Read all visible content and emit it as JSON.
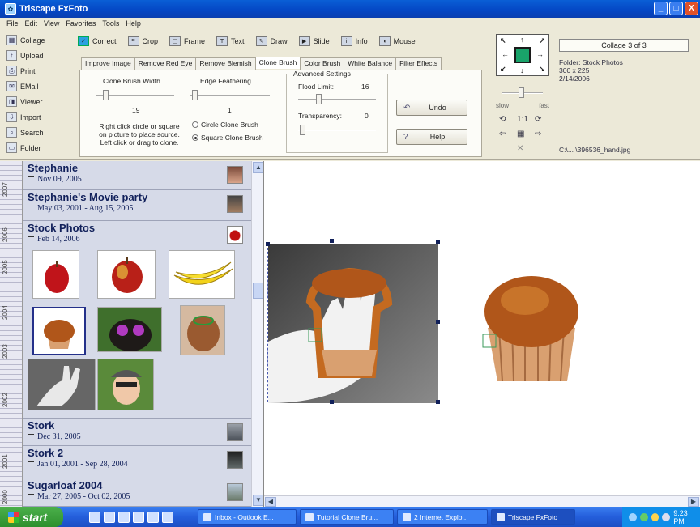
{
  "window": {
    "title": "Triscape FxFoto",
    "buttons": [
      "_",
      "□",
      "X"
    ]
  },
  "menu": [
    "File",
    "Edit",
    "View",
    "Favorites",
    "Tools",
    "Help"
  ],
  "left_tools": [
    "Collage",
    "Upload",
    "Print",
    "EMail",
    "Viewer",
    "Import",
    "Search",
    "Folder"
  ],
  "main_tabs": [
    {
      "label": "Correct",
      "active": true
    },
    {
      "label": "Crop"
    },
    {
      "label": "Frame"
    },
    {
      "label": "Text"
    },
    {
      "label": "Draw"
    },
    {
      "label": "Slide"
    },
    {
      "label": "Info"
    },
    {
      "label": "Mouse"
    }
  ],
  "sub_tabs": [
    {
      "label": "Improve Image"
    },
    {
      "label": "Remove Red Eye"
    },
    {
      "label": "Remove Blemish"
    },
    {
      "label": "Clone Brush",
      "active": true
    },
    {
      "label": "Color Brush"
    },
    {
      "label": "White Balance"
    },
    {
      "label": "Filter Effects"
    }
  ],
  "clone_panel": {
    "width_label": "Clone Brush Width",
    "width_value": "19",
    "feather_label": "Edge Feathering",
    "feather_value": "1",
    "instructions": [
      "Right click circle or square",
      "on picture to place source.",
      "Left click or drag to clone."
    ],
    "radio_circle": "Circle Clone Brush",
    "radio_square": "Square Clone Brush",
    "advanced_title": "Advanced Settings",
    "flood_label": "Flood Limit:",
    "flood_value": "16",
    "transparency_label": "Transparency:",
    "transparency_value": "0",
    "undo_label": "Undo",
    "help_label": "Help"
  },
  "nav": {
    "slow": "slow",
    "fast": "fast"
  },
  "info": {
    "collage": "Collage 3 of 3",
    "folder": "Folder: Stock Photos",
    "size": "300 x 225",
    "date": "2/14/2006",
    "path": "C:\\... \\396536_hand.jpg"
  },
  "timeline_years": [
    "2007",
    "2006",
    "2005",
    "2004",
    "2003",
    "2002",
    "2001",
    "2000"
  ],
  "albums": [
    {
      "name": "Stephanie",
      "date": "Nov 09, 2005"
    },
    {
      "name": "Stephanie's Movie party",
      "date": "May 03, 2001 - Aug 15, 2005"
    },
    {
      "name": "Stock Photos",
      "date": "Feb 14, 2006"
    },
    {
      "name": "Stork",
      "date": "Dec 31, 2005"
    },
    {
      "name": "Stork 2",
      "date": "Jan 01, 2001 - Sep 28, 2004"
    },
    {
      "name": "Sugarloaf 2004",
      "date": "Mar 27, 2005 - Oct 02, 2005"
    }
  ],
  "taskbar": {
    "start": "start",
    "tasks": [
      "Inbox - Outlook E...",
      "Tutorial Clone Bru...",
      "2 Internet Explo...",
      "Triscape FxFoto"
    ],
    "clock": "9:23 PM"
  }
}
